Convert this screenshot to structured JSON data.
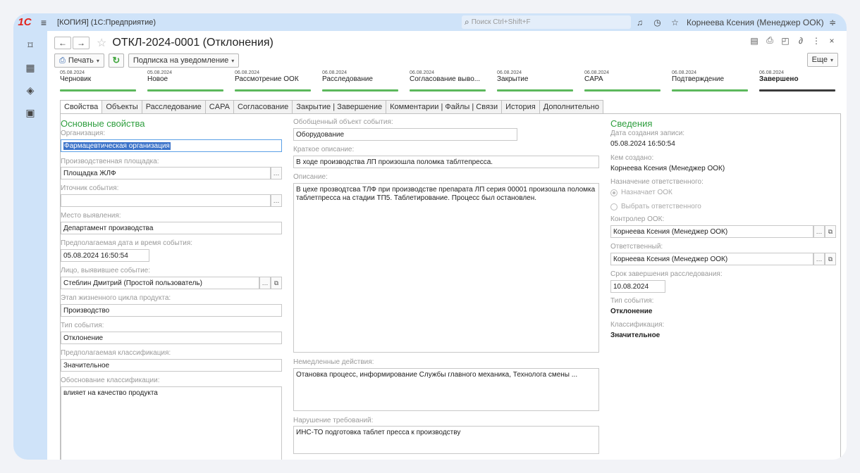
{
  "app": {
    "title": "[КОПИЯ]  (1С:Предприятие)",
    "search_placeholder": "Поиск Ctrl+Shift+F",
    "user": "Корнеева Ксения (Менеджер ООК)"
  },
  "document": {
    "title": "ОТКЛ-2024-0001 (Отклонения)"
  },
  "toolbar": {
    "print": "Печать",
    "subscribe": "Подписка на уведомление",
    "more": "Еще"
  },
  "stages": [
    {
      "date": "05.08.2024",
      "name": "Черновик"
    },
    {
      "date": "05.08.2024",
      "name": "Новое"
    },
    {
      "date": "06.08.2024",
      "name": "Рассмотрение ООК"
    },
    {
      "date": "06.08.2024",
      "name": "Расследование"
    },
    {
      "date": "06.08.2024",
      "name": "Согласование выво..."
    },
    {
      "date": "06.08.2024",
      "name": "Закрытие"
    },
    {
      "date": "06.08.2024",
      "name": "CAPA"
    },
    {
      "date": "06.08.2024",
      "name": "Подтверждение"
    },
    {
      "date": "06.08.2024",
      "name": "Завершено"
    }
  ],
  "tabs": [
    "Свойства",
    "Объекты",
    "Расследование",
    "CAPA",
    "Согласование",
    "Закрытие | Завершение",
    "Комментарии | Файлы | Связи",
    "История",
    "Дополнительно"
  ],
  "left": {
    "section": "Основные свойства",
    "org_label": "Организация:",
    "org_value": "Фармацевтическая организация",
    "site_label": "Производственная площадка:",
    "site_value": "Площадка ЖЛФ",
    "source_label": "Иточник события:",
    "source_value": "",
    "place_label": "Место выявления:",
    "place_value": "Департамент производства",
    "date_label": "Предполагаемая дата и время события:",
    "date_value": "05.08.2024 16:50:54",
    "person_label": "Лицо, выявившее событие:",
    "person_value": "Стеблин Дмитрий (Простой пользователь)",
    "stage_label": "Этап жизненного цикла продукта:",
    "stage_value": "Производство",
    "type_label": "Тип события:",
    "type_value": "Отклонение",
    "class_label": "Предполагаемая классификация:",
    "class_value": "Значительное",
    "basis_label": "Обоснование классификации:",
    "basis_value": "влияет на качество продукта"
  },
  "middle": {
    "object_label": "Обобщенный объект события:",
    "object_value": "Оборудование",
    "short_label": "Краткое описание:",
    "short_value": "В ходе производства ЛП произошла поломка таблтепресса.",
    "desc_label": "Описание:",
    "desc_value": "В цехе прозводтсва ТЛФ при производстве препарата ЛП серия 00001 произошла поломка таблетпресса на стадии ТП5. Таблетирование. Процесс был остановлен.",
    "actions_label": "Немедленные действия:",
    "actions_value": "Отановка процесс, информирование Службы главного механика, Технолога смены ...",
    "violation_label": "Нарушение требований:",
    "violation_value": "ИНС-ТО подготовка таблет пресса к производству"
  },
  "right": {
    "section": "Сведения",
    "created_label": "Дата создания записи:",
    "created_value": "05.08.2024 16:50:54",
    "by_label": "Кем создано:",
    "by_value": "Корнеева Ксения (Менеджер ООК)",
    "assign_label": "Назначение ответственного:",
    "assign_opt1": "Назначает ООК",
    "assign_opt2": "Выбрать ответственного",
    "ctrl_label": "Контролер ООК:",
    "ctrl_value": "Корнеева Ксения (Менеджер ООК)",
    "resp_label": "Ответственный:",
    "resp_value": "Корнеева Ксения (Менеджер ООК)",
    "term_label": "Срок завершения расследования:",
    "term_value": "10.08.2024",
    "etype_label": "Тип события:",
    "etype_value": "Отклонение",
    "eclass_label": "Классификация:",
    "eclass_value": "Значительное"
  }
}
